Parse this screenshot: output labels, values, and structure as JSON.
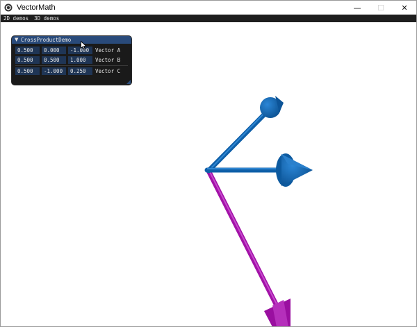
{
  "window": {
    "title": "VectorMath",
    "controls": {
      "minimize": "—",
      "maximize": "☐",
      "close": "✕"
    }
  },
  "menubar": {
    "items": [
      "2D demos",
      "3D demos"
    ]
  },
  "panel": {
    "title": "CrossProductDemo",
    "arrow": "▼",
    "rows": [
      {
        "values": [
          "0.500",
          "0.000",
          "-1.000"
        ],
        "label": "Vector A"
      },
      {
        "values": [
          "0.500",
          "0.500",
          "1.000"
        ],
        "label": "Vector B"
      },
      {
        "values": [
          "0.500",
          "-1.000",
          "0.250"
        ],
        "label": "Vector C"
      }
    ]
  },
  "icons": {
    "app": "app-logo-icon",
    "cursor": "mouse-cursor-icon",
    "collapse": "collapse-arrow-icon"
  },
  "colors": {
    "menubar": "#1e1e1e",
    "panel_bg": "#1a1a1a",
    "panel_header": "#294a7a",
    "field_bg": "#1f3555",
    "vector_blue": "#0e5fa8",
    "vector_magenta": "#a312a8"
  }
}
